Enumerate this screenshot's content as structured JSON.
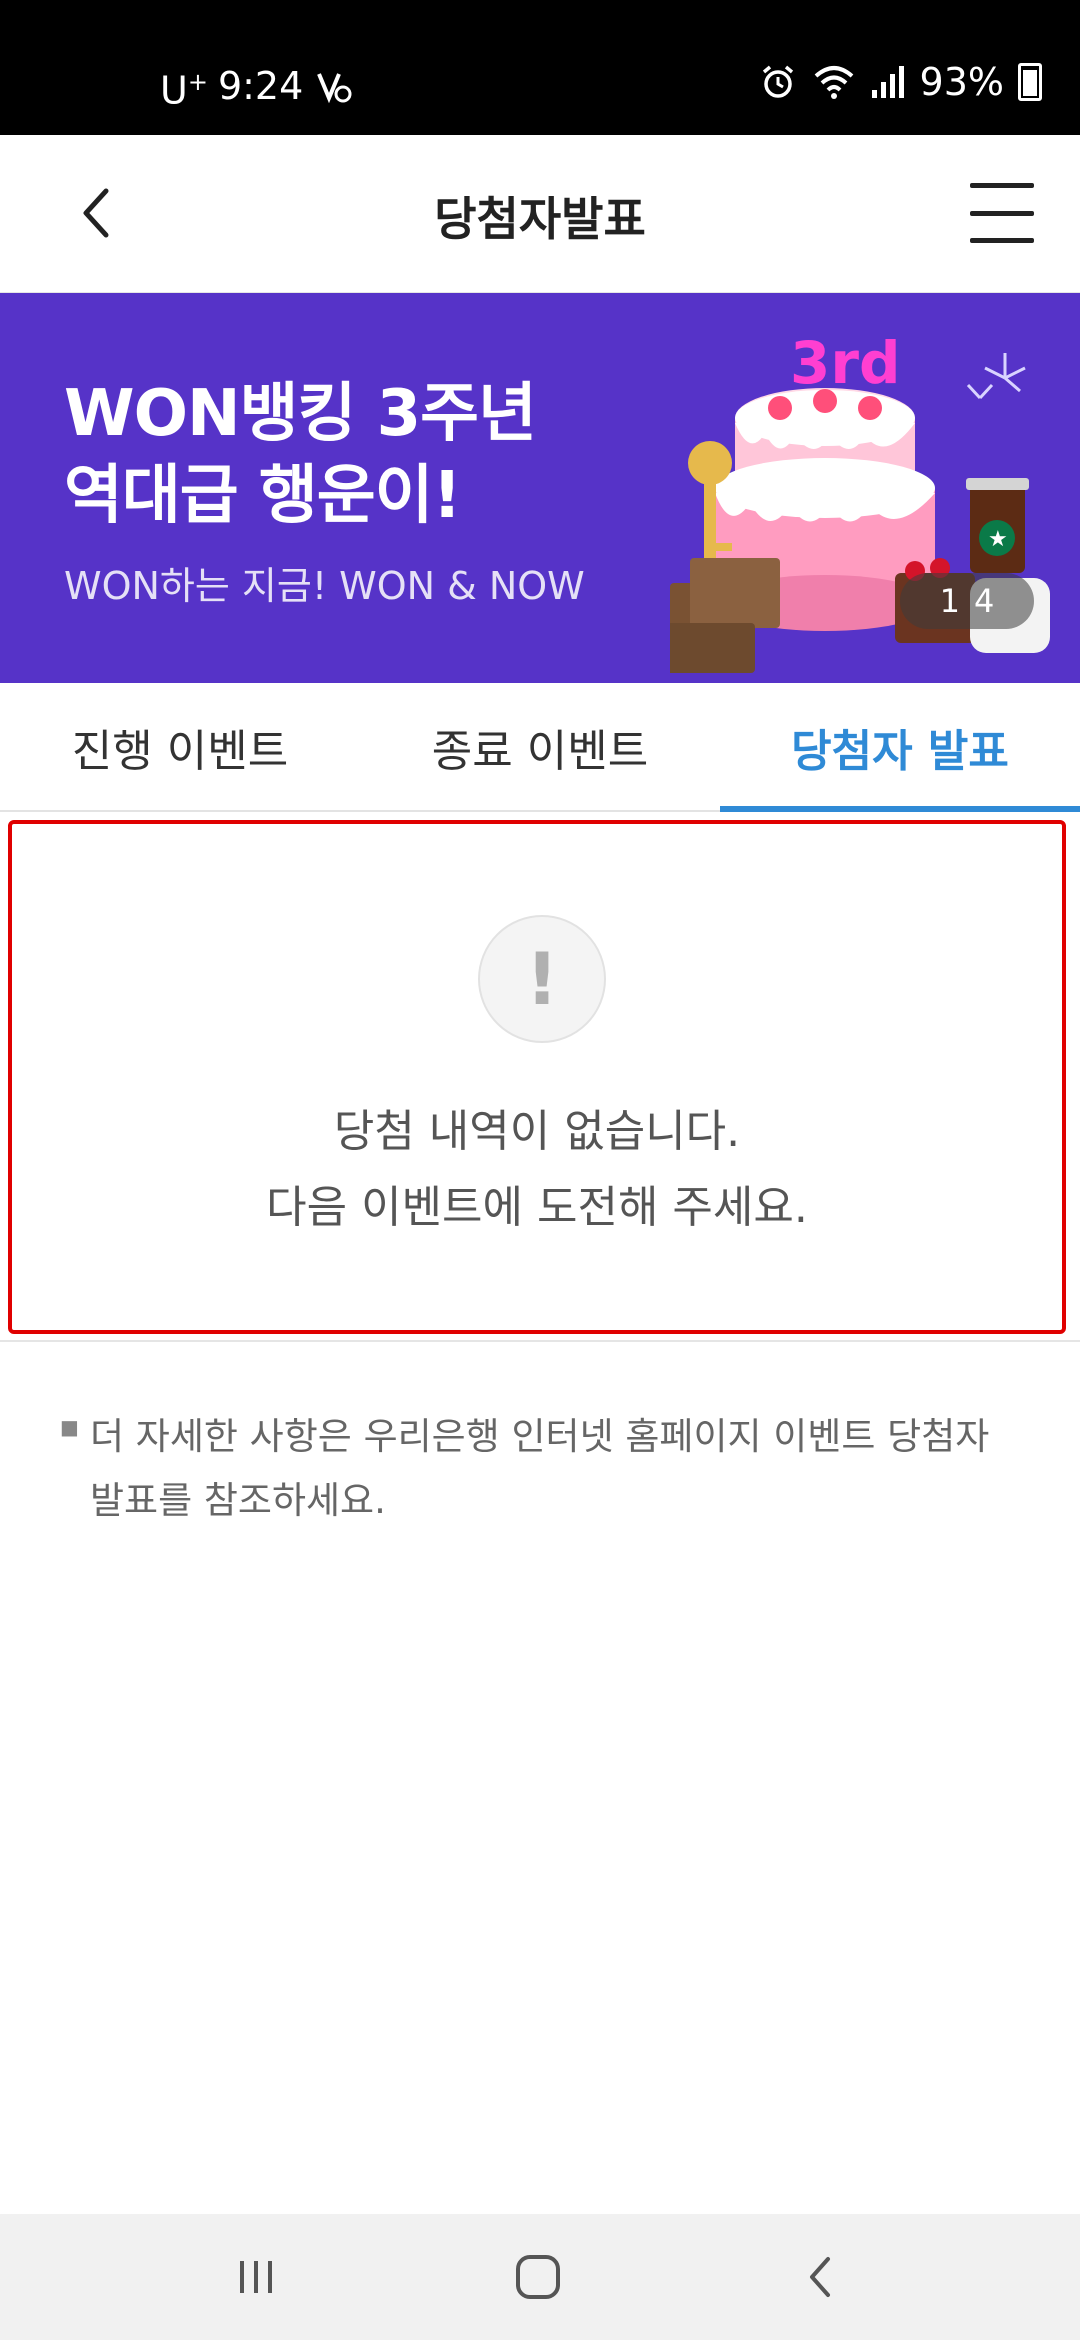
{
  "status_bar": {
    "carrier": "U",
    "carrier_sup": "+",
    "time": "9:24",
    "battery": "93%"
  },
  "header": {
    "title": "당첨자발표"
  },
  "banner": {
    "title": "WON뱅킹 3주년\n역대급 행운이!",
    "subtitle": "WON하는 지금! WON & NOW",
    "counter_current": "1",
    "counter_total": "4"
  },
  "tabs": [
    {
      "label": "진행 이벤트",
      "active": false
    },
    {
      "label": "종료 이벤트",
      "active": false
    },
    {
      "label": "당첨자 발표",
      "active": true
    }
  ],
  "empty_state": {
    "icon": "exclamation-icon",
    "line1": "당첨 내역이 없습니다.",
    "line2": "다음 이벤트에 도전해 주세요."
  },
  "note": {
    "text": "더 자세한 사항은 우리은행 인터넷 홈페이지 이벤트 당첨자 발표를 참조하세요."
  },
  "colors": {
    "banner_bg": "#5633c8",
    "active_tab": "#2f8ad6",
    "highlight_border": "#e00000"
  }
}
